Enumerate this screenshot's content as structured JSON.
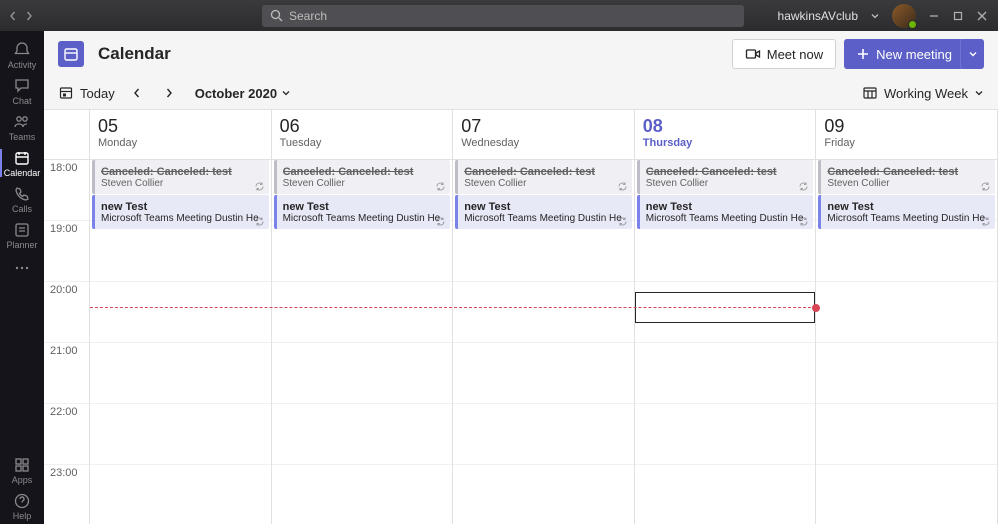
{
  "titlebar": {
    "search_placeholder": "Search",
    "username": "hawkinsAVclub"
  },
  "rail": {
    "items": [
      {
        "id": "activity",
        "label": "Activity"
      },
      {
        "id": "chat",
        "label": "Chat"
      },
      {
        "id": "teams",
        "label": "Teams"
      },
      {
        "id": "calendar",
        "label": "Calendar"
      },
      {
        "id": "calls",
        "label": "Calls"
      },
      {
        "id": "planner",
        "label": "Planner"
      }
    ],
    "apps_label": "Apps",
    "help_label": "Help"
  },
  "header": {
    "title": "Calendar",
    "meet_now_label": "Meet now",
    "new_meeting_label": "New meeting"
  },
  "toolbar": {
    "today_label": "Today",
    "month_label": "October 2020",
    "view_label": "Working Week"
  },
  "times": [
    "18:00",
    "19:00",
    "20:00",
    "21:00",
    "22:00",
    "23:00"
  ],
  "days": [
    {
      "num": "05",
      "name": "Monday",
      "today": false
    },
    {
      "num": "06",
      "name": "Tuesday",
      "today": false
    },
    {
      "num": "07",
      "name": "Wednesday",
      "today": false
    },
    {
      "num": "08",
      "name": "Thursday",
      "today": true
    },
    {
      "num": "09",
      "name": "Friday",
      "today": false
    }
  ],
  "event_templates": {
    "canceled": {
      "title": "Canceled: Canceled: test",
      "sub": "Steven Collier"
    },
    "meeting": {
      "title": "new Test",
      "sub": "Microsoft Teams Meeting  Dustin He"
    }
  },
  "colors": {
    "accent": "#5b5fc7",
    "now": "#d74654"
  }
}
